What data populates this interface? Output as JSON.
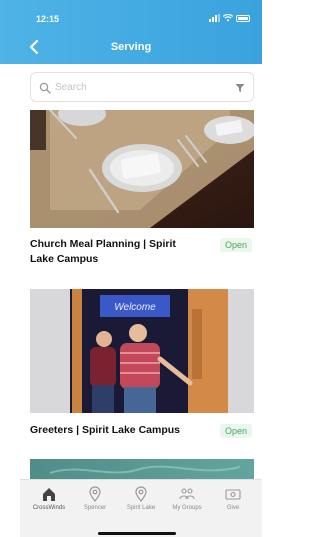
{
  "status_bar": {
    "time": "12:15"
  },
  "header": {
    "title": "Serving",
    "back_icon": "chevron-left-icon"
  },
  "search": {
    "placeholder": "Search",
    "filter_icon": "filter-icon"
  },
  "cards": [
    {
      "title": "Church Meal Planning | Spirit Lake Campus",
      "status": "Open",
      "image": "table-setting-photo"
    },
    {
      "title": "Greeters | Spirit Lake Campus",
      "status": "Open",
      "image": "greeters-doorway-photo",
      "sign_text": "Welcome"
    },
    {
      "title": "",
      "status": "",
      "image": "map-photo-partial"
    }
  ],
  "tabbar": {
    "items": [
      {
        "label": "CrossWinds",
        "icon": "church-icon",
        "active": true
      },
      {
        "label": "Spencer",
        "icon": "location-pin-icon",
        "active": false
      },
      {
        "label": "Spirit Lake",
        "icon": "location-pin-icon",
        "active": false
      },
      {
        "label": "My Groups",
        "icon": "people-icon",
        "active": false
      },
      {
        "label": "Give",
        "icon": "cash-icon",
        "active": false
      }
    ]
  },
  "colors": {
    "header": "#3aa2de",
    "badge_text": "#4aa564",
    "badge_bg": "#ebf6ec"
  }
}
